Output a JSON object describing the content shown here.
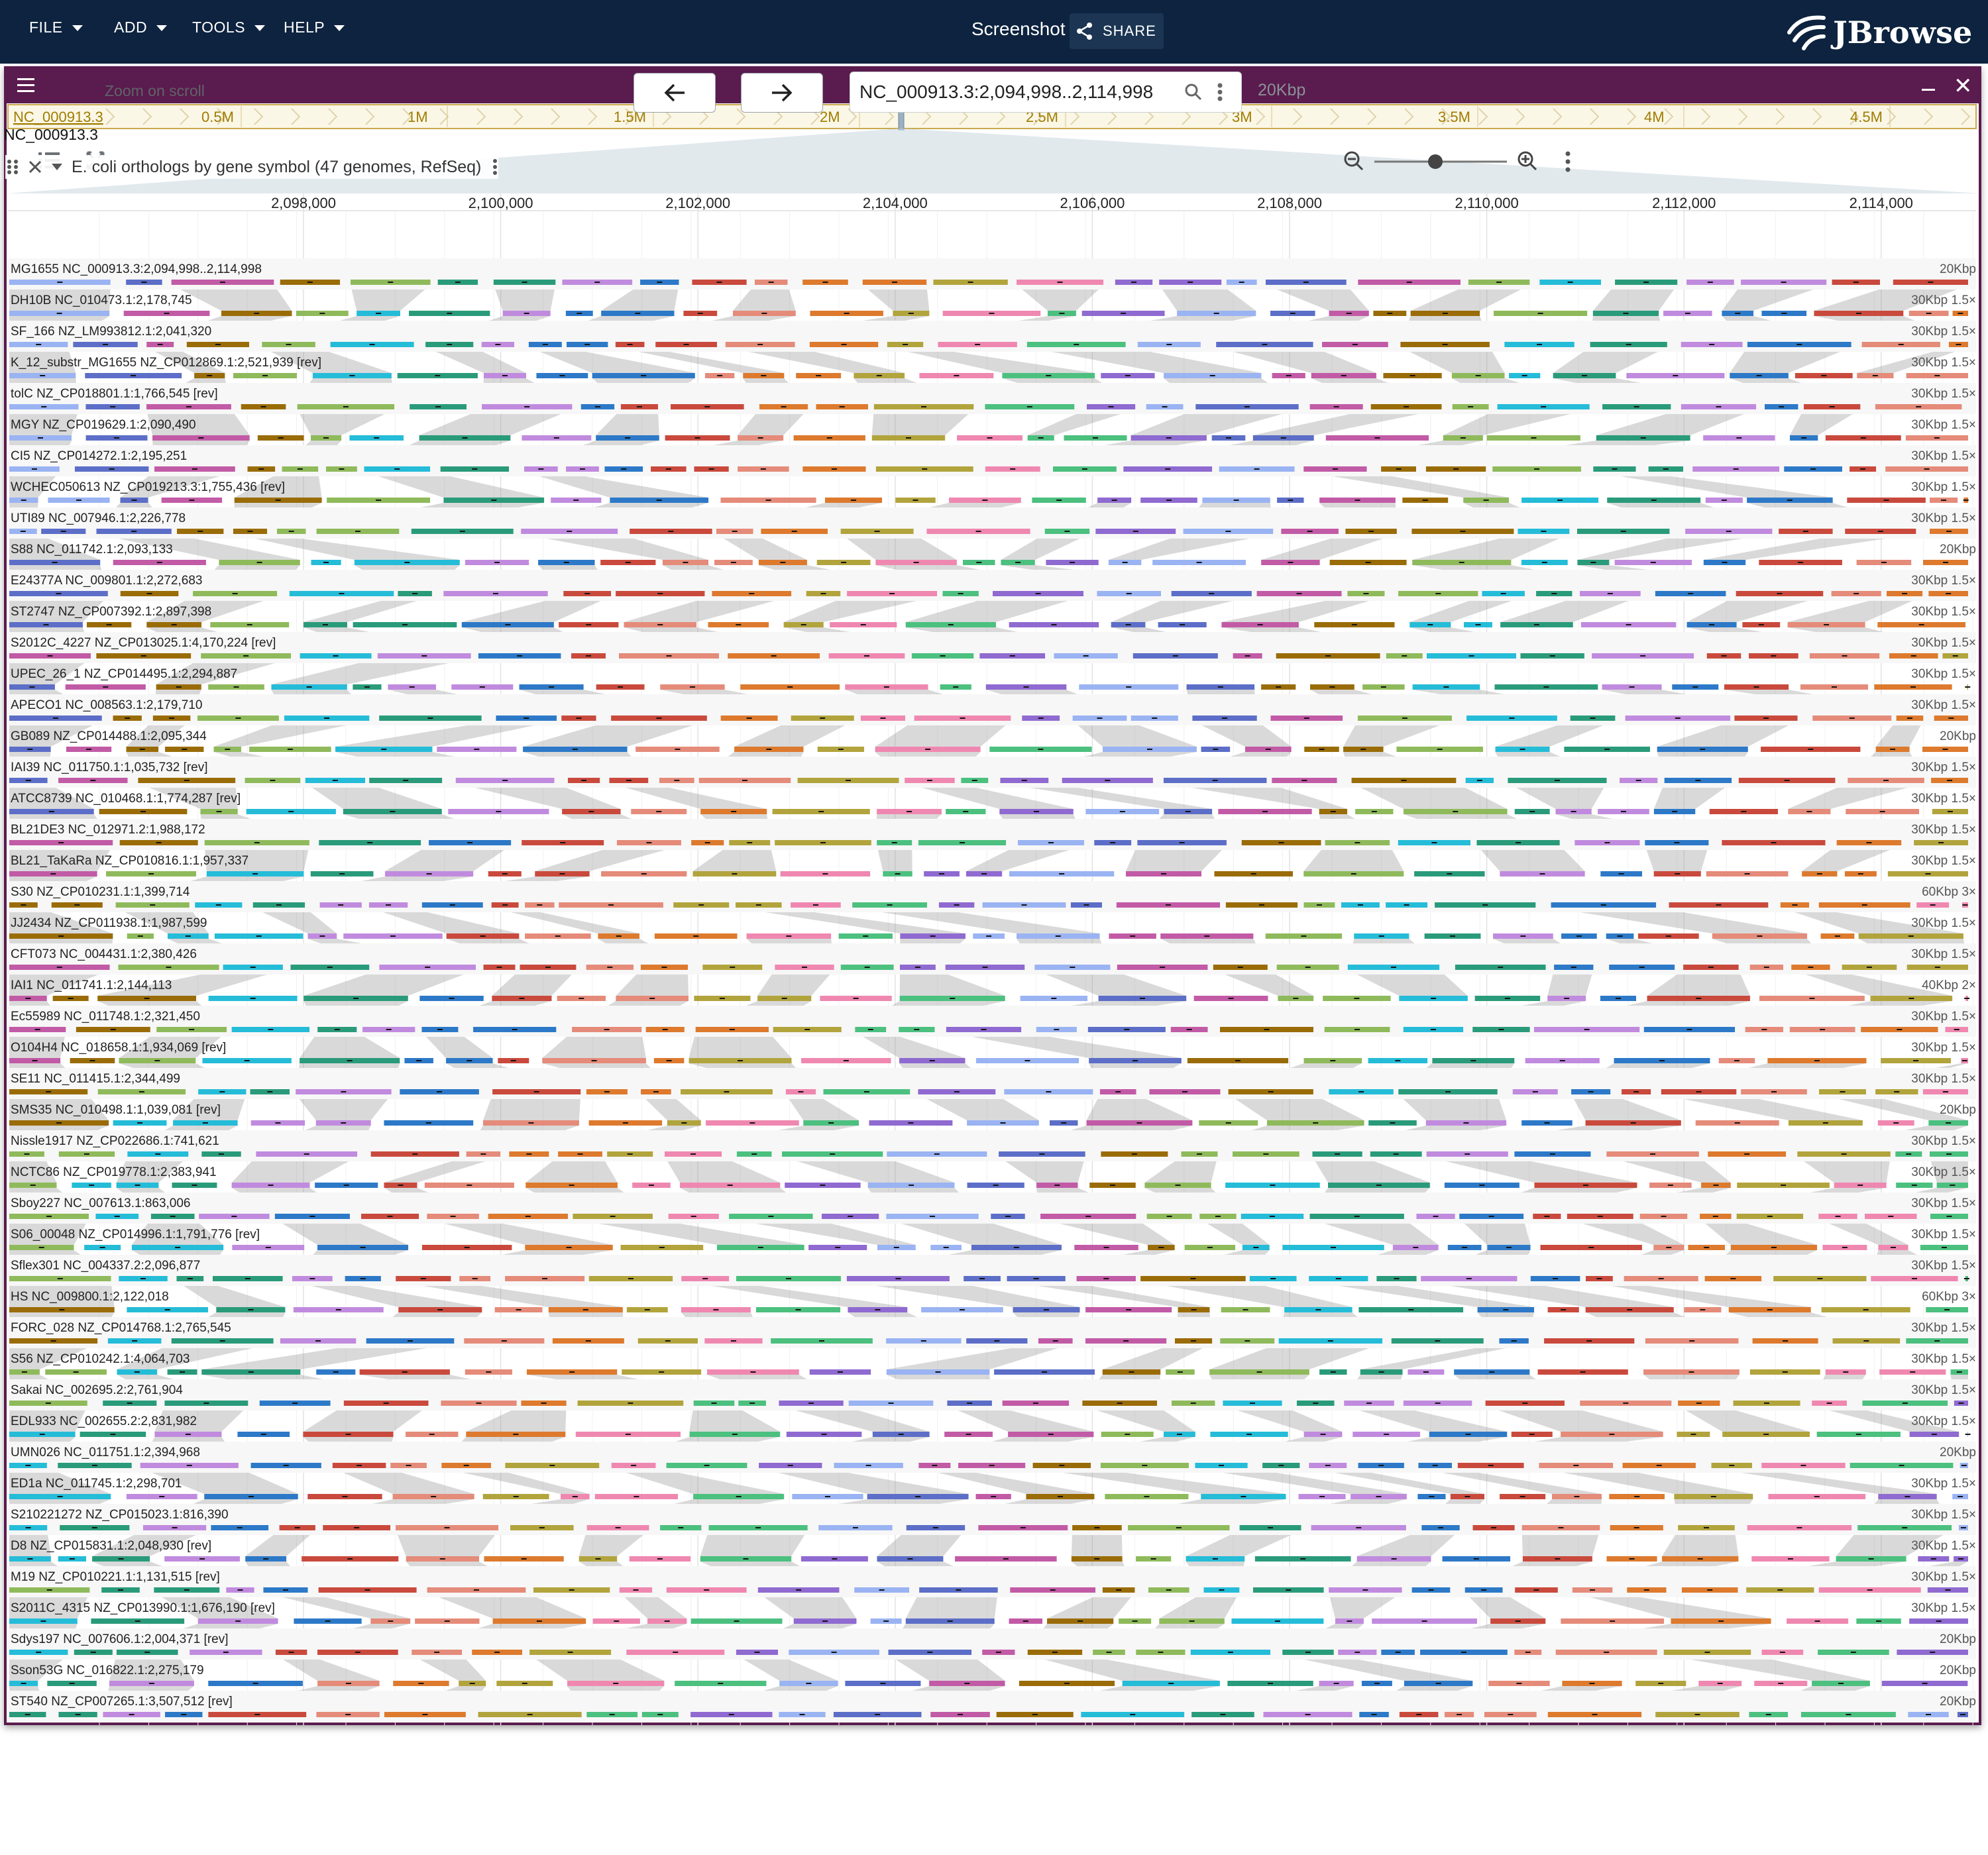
{
  "appbar": {
    "menus": [
      "FILE",
      "ADD",
      "TOOLS",
      "HELP"
    ],
    "title": "Screenshot",
    "share_label": "SHARE",
    "brand": "JBrowse"
  },
  "view": {
    "title": "MG1655",
    "overview": {
      "refname": "NC_000913.3",
      "ticks": [
        "0.5M",
        "1M",
        "1.5M",
        "2M",
        "2.5M",
        "3M",
        "3.5M",
        "4M",
        "4.5M"
      ]
    },
    "toolbar": {
      "zoom_on_scroll_label": "Zoom on scroll",
      "location": "NC_000913.3:2,094,998..2,114,998",
      "bp_per_px_label": "20Kbp"
    },
    "ruler": {
      "refname": "NC_000913.3",
      "ticks": [
        "2,098,000",
        "2,100,000",
        "2,102,000",
        "2,104,000",
        "2,106,000",
        "2,108,000",
        "2,110,000",
        "2,112,000",
        "2,114,000"
      ]
    },
    "track_label": "E. coli orthologs by gene symbol (47 genomes, RefSeq)",
    "genomes": [
      {
        "label": "MG1655 NC_000913.3:2,094,998..2,114,998",
        "scale": "20Kbp"
      },
      {
        "label": "DH10B NC_010473.1:2,178,745",
        "scale": "30Kbp 1.5×"
      },
      {
        "label": "SF_166 NZ_LM993812.1:2,041,320",
        "scale": "30Kbp 1.5×"
      },
      {
        "label": "K_12_substr_MG1655 NZ_CP012869.1:2,521,939 [rev]",
        "scale": "30Kbp 1.5×"
      },
      {
        "label": "tolC NZ_CP018801.1:1,766,545 [rev]",
        "scale": "30Kbp 1.5×"
      },
      {
        "label": "MGY NZ_CP019629.1:2,090,490",
        "scale": "30Kbp 1.5×"
      },
      {
        "label": "CI5 NZ_CP014272.1:2,195,251",
        "scale": "30Kbp 1.5×"
      },
      {
        "label": "WCHEC050613 NZ_CP019213.3:1,755,436 [rev]",
        "scale": "30Kbp 1.5×"
      },
      {
        "label": "UTI89 NC_007946.1:2,226,778",
        "scale": "30Kbp 1.5×"
      },
      {
        "label": "S88 NC_011742.1:2,093,133",
        "scale": "20Kbp"
      },
      {
        "label": "E24377A NC_009801.1:2,272,683",
        "scale": "30Kbp 1.5×"
      },
      {
        "label": "ST2747 NZ_CP007392.1:2,897,398",
        "scale": "30Kbp 1.5×"
      },
      {
        "label": "S2012C_4227 NZ_CP013025.1:4,170,224 [rev]",
        "scale": "30Kbp 1.5×"
      },
      {
        "label": "UPEC_26_1 NZ_CP014495.1:2,294,887",
        "scale": "30Kbp 1.5×"
      },
      {
        "label": "APECO1 NC_008563.1:2,179,710",
        "scale": "30Kbp 1.5×"
      },
      {
        "label": "GB089 NZ_CP014488.1:2,095,344",
        "scale": "20Kbp"
      },
      {
        "label": "IAI39 NC_011750.1:1,035,732 [rev]",
        "scale": "30Kbp 1.5×"
      },
      {
        "label": "ATCC8739 NC_010468.1:1,774,287 [rev]",
        "scale": "30Kbp 1.5×"
      },
      {
        "label": "BL21DE3 NC_012971.2:1,988,172",
        "scale": "30Kbp 1.5×"
      },
      {
        "label": "BL21_TaKaRa NZ_CP010816.1:1,957,337",
        "scale": "30Kbp 1.5×"
      },
      {
        "label": "S30 NZ_CP010231.1:1,399,714",
        "scale": "60Kbp 3×"
      },
      {
        "label": "JJ2434 NZ_CP011938.1:1,987,599",
        "scale": "30Kbp 1.5×"
      },
      {
        "label": "CFT073 NC_004431.1:2,380,426",
        "scale": "30Kbp 1.5×"
      },
      {
        "label": "IAI1 NC_011741.1:2,144,113",
        "scale": "40Kbp 2×"
      },
      {
        "label": "Ec55989 NC_011748.1:2,321,450",
        "scale": "30Kbp 1.5×"
      },
      {
        "label": "O104H4 NC_018658.1:1,934,069 [rev]",
        "scale": "30Kbp 1.5×"
      },
      {
        "label": "SE11 NC_011415.1:2,344,499",
        "scale": "30Kbp 1.5×"
      },
      {
        "label": "SMS35 NC_010498.1:1,039,081 [rev]",
        "scale": "20Kbp"
      },
      {
        "label": "Nissle1917 NZ_CP022686.1:741,621",
        "scale": "30Kbp 1.5×"
      },
      {
        "label": "NCTC86 NZ_CP019778.1:2,383,941",
        "scale": "30Kbp 1.5×"
      },
      {
        "label": "Sboy227 NC_007613.1:863,006",
        "scale": "30Kbp 1.5×"
      },
      {
        "label": "S06_00048 NZ_CP014996.1:1,791,776 [rev]",
        "scale": "30Kbp 1.5×"
      },
      {
        "label": "Sflex301 NC_004337.2:2,096,877",
        "scale": "30Kbp 1.5×"
      },
      {
        "label": "HS NC_009800.1:2,122,018",
        "scale": "60Kbp 3×"
      },
      {
        "label": "FORC_028 NZ_CP014768.1:2,765,545",
        "scale": "30Kbp 1.5×"
      },
      {
        "label": "S56 NZ_CP010242.1:4,064,703",
        "scale": "30Kbp 1.5×"
      },
      {
        "label": "Sakai NC_002695.2:2,761,904",
        "scale": "30Kbp 1.5×"
      },
      {
        "label": "EDL933 NC_002655.2:2,831,982",
        "scale": "30Kbp 1.5×"
      },
      {
        "label": "UMN026 NC_011751.1:2,394,968",
        "scale": "20Kbp"
      },
      {
        "label": "ED1a NC_011745.1:2,298,701",
        "scale": "30Kbp 1.5×"
      },
      {
        "label": "S210221272 NZ_CP015023.1:816,390",
        "scale": "30Kbp 1.5×"
      },
      {
        "label": "D8 NZ_CP015831.1:2,048,930 [rev]",
        "scale": "30Kbp 1.5×"
      },
      {
        "label": "M19 NZ_CP010221.1:1,131,515 [rev]",
        "scale": "30Kbp 1.5×"
      },
      {
        "label": "S2011C_4315 NZ_CP013990.1:1,676,190 [rev]",
        "scale": "30Kbp 1.5×"
      },
      {
        "label": "Sdys197 NC_007606.1:2,004,371 [rev]",
        "scale": "20Kbp"
      },
      {
        "label": "Sson53G NC_016822.1:2,275,179",
        "scale": "20Kbp"
      },
      {
        "label": "ST540 NZ_CP007265.1:3,507,512 [rev]",
        "scale": "20Kbp"
      }
    ],
    "gene_palette": [
      "#9ab3f2",
      "#5c6ec7",
      "#c25ba6",
      "#9a6c08",
      "#8fba5b",
      "#25bcd8",
      "#2a9b7a",
      "#c08bde",
      "#2d79c8",
      "#c94a3d",
      "#e58b7a",
      "#dd7a2e",
      "#b2a43d",
      "#ef88b0",
      "#4cc07f",
      "#8f6ad0"
    ]
  }
}
